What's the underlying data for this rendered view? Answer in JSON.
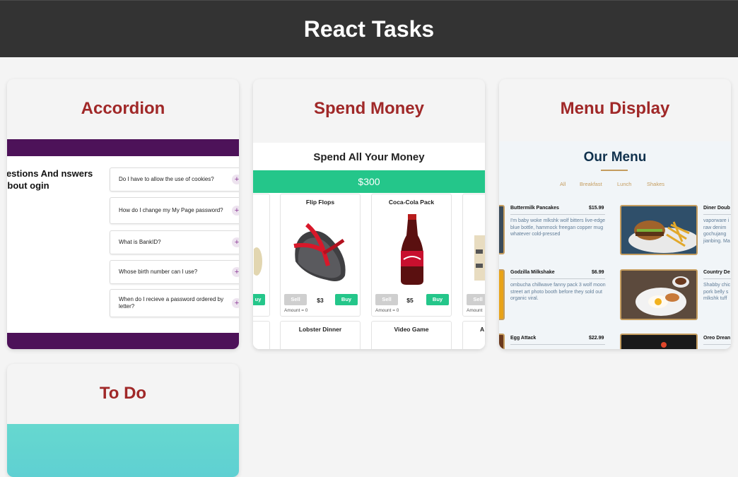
{
  "header": {
    "title": "React Tasks"
  },
  "cards": {
    "accordion": {
      "title": "Accordion",
      "heading": "uestions And nswers About ogin",
      "items": [
        "Do I have to allow the use of cookies?",
        "How do I change my My Page password?",
        "What is BankID?",
        "Whose birth number can I use?",
        "When do I recieve a password ordered by letter?"
      ],
      "expand_symbol": "+"
    },
    "spend": {
      "title": "Spend Money",
      "preview_title": "Spend All Your Money",
      "money": "$300",
      "products": [
        {
          "name": "Flip Flops",
          "price": "$3",
          "amount": "Amount = 0"
        },
        {
          "name": "Coca-Cola Pack",
          "price": "$5",
          "amount": "Amount = 0"
        },
        {
          "name": "Lobster Dinner"
        },
        {
          "name": "Video Game"
        }
      ],
      "sell_label": "Sell",
      "buy_label": "Buy",
      "partial_buy": "uy",
      "partial_amount": "Amount",
      "partial_right_letter": "A"
    },
    "menu": {
      "title": "Menu Display",
      "preview_title": "Our Menu",
      "categories": [
        "All",
        "Breakfast",
        "Lunch",
        "Shakes"
      ],
      "items": [
        {
          "name": "Buttermilk Pancakes",
          "price": "$15.99",
          "desc": "I'm baby woke mlkshk wolf bitters live-edge blue bottle, hammock freegan copper mug whatever cold-pressed"
        },
        {
          "name": "Godzilla Milkshake",
          "price": "$6.99",
          "desc": "ombucha chillwave fanny pack 3 wolf moon street art photo booth before they sold out organic viral."
        },
        {
          "name": "Egg Attack",
          "price": "$22.99"
        }
      ],
      "right_items": [
        {
          "name": "Diner Doub",
          "desc": "vaporware i raw denim gochujang jianbing. Ma"
        },
        {
          "name": "Country De",
          "desc": "Shabby chic pork belly s mlkshk tuff"
        },
        {
          "name": "Oreo Drean"
        }
      ]
    },
    "todo": {
      "title": "To Do"
    }
  },
  "colors": {
    "header_bg": "#333333",
    "card_title": "#a02828",
    "accordion_band": "#4d1259",
    "money_green": "#24c68a",
    "menu_gold": "#c59d5f"
  }
}
